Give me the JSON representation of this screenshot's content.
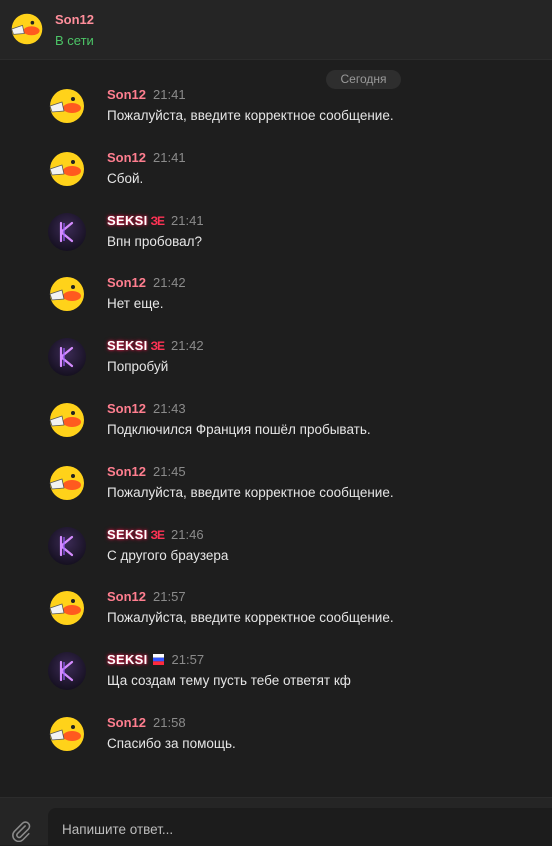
{
  "header": {
    "name": "Son12",
    "status": "В сети",
    "avatar_icon": "duck-sticker-icon"
  },
  "date_label": "Сегодня",
  "colors": {
    "son12_name": "#ff7e8f",
    "online": "#4cc466",
    "seksi_glow": "#e0204a",
    "background": "#1e1e1e"
  },
  "messages": [
    {
      "author": "Son12",
      "time": "21:41",
      "text": "Пожалуйста, введите корректное сообщение.",
      "avatar": "duck"
    },
    {
      "author": "Son12",
      "time": "21:41",
      "text": "Сбой.",
      "avatar": "duck"
    },
    {
      "author": "SEKSI",
      "badge": "ЗЕ",
      "time": "21:41",
      "text": "Впн пробовал?",
      "avatar": "k"
    },
    {
      "author": "Son12",
      "time": "21:42",
      "text": "Нет еще.",
      "avatar": "duck"
    },
    {
      "author": "SEKSI",
      "badge": "ЗЕ",
      "time": "21:42",
      "text": "Попробуй",
      "avatar": "k"
    },
    {
      "author": "Son12",
      "time": "21:43",
      "text": "Подключился Франция пошёл пробывать.",
      "avatar": "duck"
    },
    {
      "author": "Son12",
      "time": "21:45",
      "text": "Пожалуйста, введите корректное сообщение.",
      "avatar": "duck"
    },
    {
      "author": "SEKSI",
      "badge": "ЗЕ",
      "time": "21:46",
      "text": "С другого браузера",
      "avatar": "k"
    },
    {
      "author": "Son12",
      "time": "21:57",
      "text": "Пожалуйста, введите корректное сообщение.",
      "avatar": "duck"
    },
    {
      "author": "SEKSI",
      "badge": "flag",
      "time": "21:57",
      "text": "Ща создам тему пусть тебе ответят кф",
      "avatar": "k"
    },
    {
      "author": "Son12",
      "time": "21:58",
      "text": "Спасибо за помощь.",
      "avatar": "duck"
    }
  ],
  "composer": {
    "placeholder": "Напишите ответ...",
    "attach_icon": "paperclip-icon"
  }
}
